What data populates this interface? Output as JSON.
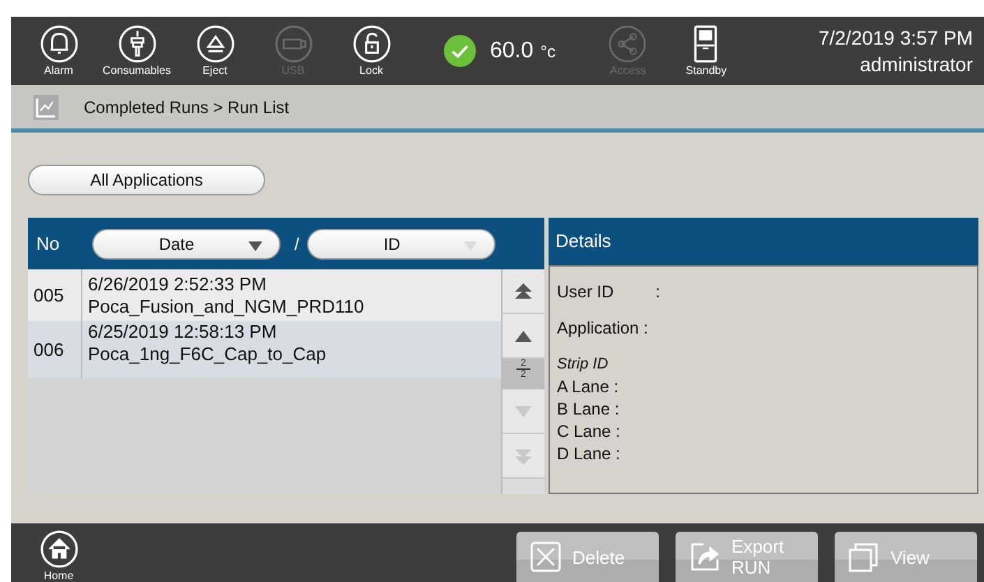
{
  "toolbar": {
    "items": [
      {
        "kind": "alarm",
        "label": "Alarm",
        "disabled": false
      },
      {
        "kind": "consumables",
        "label": "Consumables",
        "disabled": false
      },
      {
        "kind": "eject",
        "label": "Eject",
        "disabled": false
      },
      {
        "kind": "usb",
        "label": "USB",
        "disabled": true
      },
      {
        "kind": "lock",
        "label": "Lock",
        "disabled": false
      }
    ],
    "temperature": "60.0",
    "temperature_unit": "°c",
    "right_items": [
      {
        "kind": "access",
        "label": "Access",
        "disabled": true
      },
      {
        "kind": "standby",
        "label": "Standby",
        "disabled": false
      }
    ],
    "datetime": "7/2/2019 3:57 PM",
    "user": "administrator"
  },
  "breadcrumb": "Completed Runs > Run List",
  "filter_button": "All Applications",
  "table": {
    "no_header": "No",
    "sort_date": "Date",
    "separator": "/",
    "sort_id": "ID",
    "rows": [
      {
        "no": "005",
        "date": "6/26/2019 2:52:33 PM",
        "name": "Poca_Fusion_and_NGM_PRD110"
      },
      {
        "no": "006",
        "date": "6/25/2019 12:58:13 PM",
        "name": "Poca_1ng_F6C_Cap_to_Cap"
      }
    ]
  },
  "pager": {
    "buttons": [
      {
        "kind": "top",
        "disabled": false
      },
      {
        "kind": "up",
        "disabled": false
      },
      {
        "kind": "down",
        "disabled": true
      },
      {
        "kind": "bottom",
        "disabled": true
      }
    ],
    "page": "2",
    "pages": "2"
  },
  "details": {
    "title": "Details",
    "fields": [
      {
        "kind": "normal",
        "label": "User ID",
        "colon": ":"
      },
      {
        "kind": "normal",
        "label": "Application :"
      },
      {
        "kind": "italic",
        "label": "Strip ID"
      },
      {
        "kind": "lane",
        "label": "A Lane :"
      },
      {
        "kind": "lane",
        "label": "B Lane :"
      },
      {
        "kind": "lane",
        "label": "C Lane :"
      },
      {
        "kind": "lane",
        "label": "D Lane :"
      }
    ]
  },
  "footer": {
    "home": "Home",
    "buttons": [
      {
        "kind": "delete",
        "label": "Delete",
        "disabled": true
      },
      {
        "kind": "export",
        "label": "Export",
        "label2": "RUN",
        "disabled": true
      },
      {
        "kind": "view",
        "label": "View",
        "disabled": true
      }
    ]
  }
}
